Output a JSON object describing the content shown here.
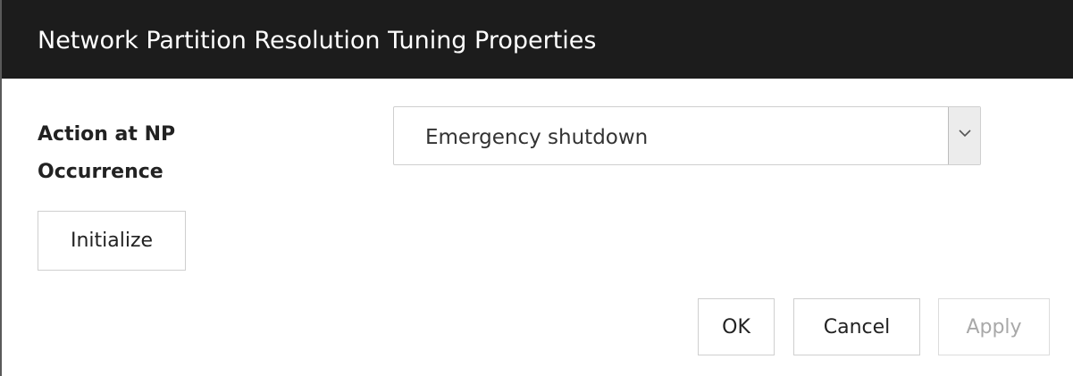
{
  "dialog": {
    "title": "Network Partition Resolution Tuning Properties"
  },
  "form": {
    "action_label_line1": "Action at NP",
    "action_label_line2": "Occurrence",
    "action_select": {
      "selected_value": "Emergency shutdown",
      "arrow_icon": "chevron-down-icon"
    }
  },
  "buttons": {
    "initialize": "Initialize",
    "ok": "OK",
    "cancel": "Cancel",
    "apply": "Apply",
    "apply_enabled": false
  },
  "colors": {
    "titlebar_bg": "#1c1c1c",
    "titlebar_text": "#ffffff",
    "disabled_text": "#a8a8a8"
  }
}
